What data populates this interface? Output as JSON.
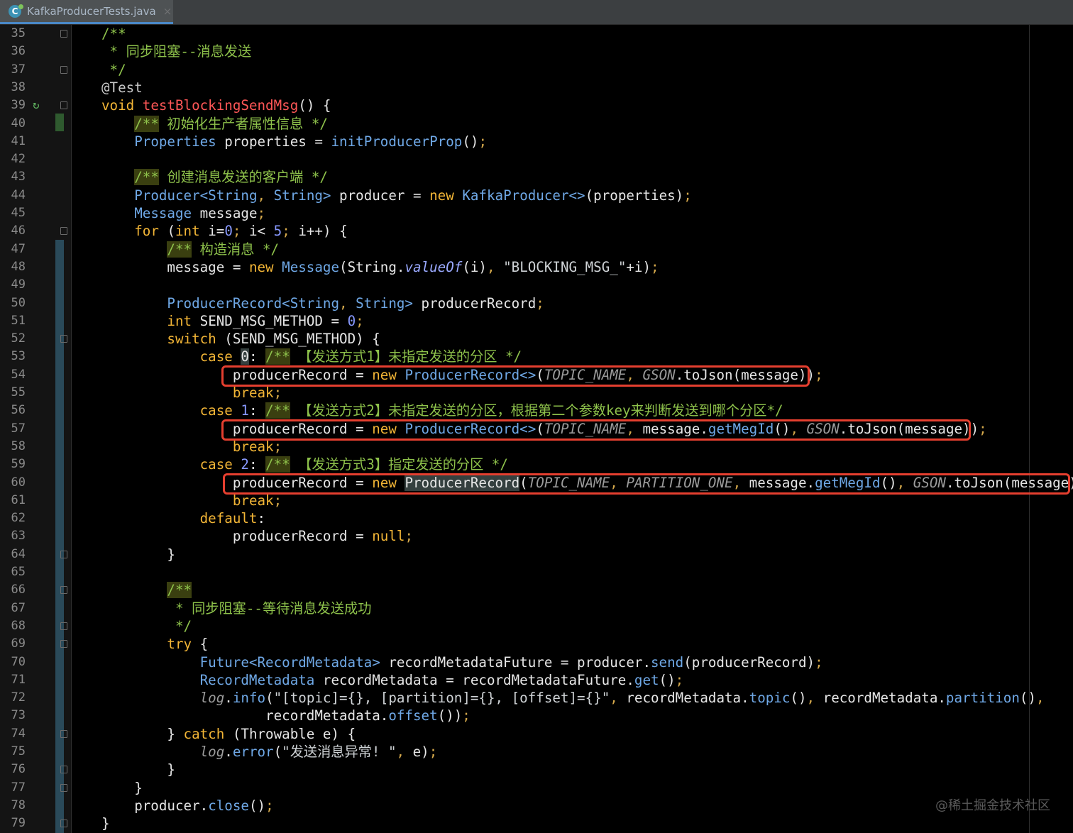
{
  "tab": {
    "title": "KafkaProducerTests.java",
    "close": "×",
    "icon": "c-class-icon"
  },
  "watermark": "@稀土掘金技术社区",
  "colors": {
    "keyword": "#f2b536",
    "comment": "#8ec24b",
    "type": "#6fa8e6",
    "method_decl": "#ff5757",
    "highlight_box": "#e53f2f"
  },
  "lines": [
    {
      "n": "35",
      "fold": true,
      "segs": [
        [
          "c",
          "/**"
        ]
      ]
    },
    {
      "n": "36",
      "segs": [
        [
          "c",
          " * 同步阻塞--消息发送"
        ]
      ]
    },
    {
      "n": "37",
      "fold": true,
      "segs": [
        [
          "c",
          " */"
        ]
      ]
    },
    {
      "n": "38",
      "segs": [
        [
          "a",
          "@Test"
        ]
      ]
    },
    {
      "n": "39",
      "fold": true,
      "run": true,
      "segs": [
        [
          "k",
          "void "
        ],
        [
          "f",
          "testBlockingSendMsg"
        ],
        [
          "",
          "() {"
        ]
      ]
    },
    {
      "n": "40",
      "segs": [
        [
          "",
          "    "
        ],
        [
          "cb",
          "/**"
        ],
        [
          "c",
          " 初始化生产者属性信息 */"
        ]
      ]
    },
    {
      "n": "41",
      "segs": [
        [
          "",
          "    "
        ],
        [
          "t",
          "Properties"
        ],
        [
          "",
          " properties = "
        ],
        [
          "m",
          "initProducerProp"
        ],
        [
          "",
          "()"
        ],
        [
          "p",
          ";"
        ]
      ]
    },
    {
      "n": "42",
      "segs": []
    },
    {
      "n": "43",
      "segs": [
        [
          "",
          "    "
        ],
        [
          "cb",
          "/**"
        ],
        [
          "c",
          " 创建消息发送的客户端 */"
        ]
      ]
    },
    {
      "n": "44",
      "segs": [
        [
          "",
          "    "
        ],
        [
          "t",
          "Producer<String"
        ],
        [
          "p",
          ", "
        ],
        [
          "t",
          "String>"
        ],
        [
          "",
          " producer = "
        ],
        [
          "k",
          "new "
        ],
        [
          "t",
          "KafkaProducer<>"
        ],
        [
          "",
          "(properties)"
        ],
        [
          "p",
          ";"
        ]
      ]
    },
    {
      "n": "45",
      "segs": [
        [
          "",
          "    "
        ],
        [
          "t",
          "Message"
        ],
        [
          "",
          " message"
        ],
        [
          "p",
          ";"
        ]
      ]
    },
    {
      "n": "46",
      "fold": true,
      "segs": [
        [
          "",
          "    "
        ],
        [
          "k",
          "for "
        ],
        [
          "",
          "("
        ],
        [
          "k",
          "int "
        ],
        [
          "",
          "i="
        ],
        [
          "n",
          "0"
        ],
        [
          "p",
          "; "
        ],
        [
          "",
          "i< "
        ],
        [
          "n",
          "5"
        ],
        [
          "p",
          "; "
        ],
        [
          "",
          "i++) {"
        ]
      ]
    },
    {
      "n": "47",
      "segs": [
        [
          "",
          "        "
        ],
        [
          "cb",
          "/**"
        ],
        [
          "c",
          " 构造消息 */"
        ]
      ]
    },
    {
      "n": "48",
      "segs": [
        [
          "",
          "        message = "
        ],
        [
          "k",
          "new "
        ],
        [
          "t",
          "Message"
        ],
        [
          "",
          "(String."
        ],
        [
          "ni",
          "valueOf"
        ],
        [
          "",
          "(i)"
        ],
        [
          "p",
          ", "
        ],
        [
          "s",
          "\"BLOCKING_MSG_\""
        ],
        [
          "",
          "+i)"
        ],
        [
          "p",
          ";"
        ]
      ]
    },
    {
      "n": "49",
      "segs": []
    },
    {
      "n": "50",
      "segs": [
        [
          "",
          "        "
        ],
        [
          "t",
          "ProducerRecord<String"
        ],
        [
          "p",
          ", "
        ],
        [
          "t",
          "String>"
        ],
        [
          "",
          " producerRecord"
        ],
        [
          "p",
          ";"
        ]
      ]
    },
    {
      "n": "51",
      "segs": [
        [
          "",
          "        "
        ],
        [
          "k",
          "int "
        ],
        [
          "",
          "SEND_MSG_METHOD = "
        ],
        [
          "n",
          "0"
        ],
        [
          "p",
          ";"
        ]
      ]
    },
    {
      "n": "52",
      "fold": true,
      "segs": [
        [
          "",
          "        "
        ],
        [
          "k",
          "switch "
        ],
        [
          "",
          "(SEND_MSG_METHOD) {"
        ]
      ]
    },
    {
      "n": "53",
      "segs": [
        [
          "",
          "            "
        ],
        [
          "k",
          "case "
        ],
        [
          "hl",
          "0"
        ],
        [
          "",
          ": "
        ],
        [
          "cb",
          "/**"
        ],
        [
          "c",
          " 【发送方式1】未指定发送的分区 */"
        ]
      ]
    },
    {
      "n": "54",
      "segs": [
        [
          "",
          "                producerRecord = "
        ],
        [
          "k",
          "new "
        ],
        [
          "t",
          "ProducerRecord<>"
        ],
        [
          "",
          "("
        ],
        [
          "ci",
          "TOPIC_NAME"
        ],
        [
          "p",
          ", "
        ],
        [
          "ci",
          "GSON"
        ],
        [
          "",
          ".toJson(message))"
        ],
        [
          "p",
          ";"
        ]
      ]
    },
    {
      "n": "55",
      "segs": [
        [
          "",
          "                "
        ],
        [
          "k",
          "break"
        ],
        [
          "p",
          ";"
        ]
      ]
    },
    {
      "n": "56",
      "segs": [
        [
          "",
          "            "
        ],
        [
          "k",
          "case "
        ],
        [
          "n",
          "1"
        ],
        [
          "",
          ": "
        ],
        [
          "cb",
          "/**"
        ],
        [
          "c",
          " 【发送方式2】未指定发送的分区，根据第二个参数key来判断发送到哪个分区*/"
        ]
      ]
    },
    {
      "n": "57",
      "segs": [
        [
          "",
          "                producerRecord = "
        ],
        [
          "k",
          "new "
        ],
        [
          "t",
          "ProducerRecord<>"
        ],
        [
          "",
          "("
        ],
        [
          "ci",
          "TOPIC_NAME"
        ],
        [
          "p",
          ", "
        ],
        [
          "",
          "message."
        ],
        [
          "m",
          "getMegId"
        ],
        [
          "",
          "()"
        ],
        [
          "p",
          ", "
        ],
        [
          "ci",
          "GSON"
        ],
        [
          "",
          ".toJson(message))"
        ],
        [
          "p",
          ";"
        ]
      ]
    },
    {
      "n": "58",
      "segs": [
        [
          "",
          "                "
        ],
        [
          "k",
          "break"
        ],
        [
          "p",
          ";"
        ]
      ]
    },
    {
      "n": "59",
      "segs": [
        [
          "",
          "            "
        ],
        [
          "k",
          "case "
        ],
        [
          "n",
          "2"
        ],
        [
          "",
          ": "
        ],
        [
          "cb",
          "/**"
        ],
        [
          "c",
          " 【发送方式3】指定发送的分区 */"
        ]
      ]
    },
    {
      "n": "60",
      "segs": [
        [
          "",
          "                producerRecord = "
        ],
        [
          "k",
          "new "
        ],
        [
          "hl",
          "ProducerRecord"
        ],
        [
          "",
          "("
        ],
        [
          "ci",
          "TOPIC_NAME"
        ],
        [
          "p",
          ", "
        ],
        [
          "ci",
          "PARTITION_ONE"
        ],
        [
          "p",
          ", "
        ],
        [
          "",
          "message."
        ],
        [
          "m",
          "getMegId"
        ],
        [
          "",
          "()"
        ],
        [
          "p",
          ", "
        ],
        [
          "ci",
          "GSON"
        ],
        [
          "",
          ".toJson(message))"
        ],
        [
          "p",
          ";"
        ]
      ]
    },
    {
      "n": "61",
      "segs": [
        [
          "",
          "                "
        ],
        [
          "k",
          "break"
        ],
        [
          "p",
          ";"
        ]
      ]
    },
    {
      "n": "62",
      "segs": [
        [
          "",
          "            "
        ],
        [
          "k",
          "default"
        ],
        [
          "",
          ":"
        ]
      ]
    },
    {
      "n": "63",
      "segs": [
        [
          "",
          "                producerRecord = "
        ],
        [
          "k",
          "null"
        ],
        [
          "p",
          ";"
        ]
      ]
    },
    {
      "n": "64",
      "fold": true,
      "segs": [
        [
          "",
          "        }"
        ]
      ]
    },
    {
      "n": "65",
      "segs": []
    },
    {
      "n": "66",
      "fold": true,
      "segs": [
        [
          "",
          "        "
        ],
        [
          "cb",
          "/**"
        ]
      ]
    },
    {
      "n": "67",
      "segs": [
        [
          "c",
          "         * 同步阻塞--等待消息发送成功"
        ]
      ]
    },
    {
      "n": "68",
      "fold": true,
      "segs": [
        [
          "c",
          "         */"
        ]
      ]
    },
    {
      "n": "69",
      "fold": true,
      "segs": [
        [
          "",
          "        "
        ],
        [
          "k",
          "try "
        ],
        [
          "",
          "{"
        ]
      ]
    },
    {
      "n": "70",
      "segs": [
        [
          "",
          "            "
        ],
        [
          "t",
          "Future<RecordMetadata>"
        ],
        [
          "",
          " recordMetadataFuture = producer."
        ],
        [
          "m",
          "send"
        ],
        [
          "",
          "(producerRecord)"
        ],
        [
          "p",
          ";"
        ]
      ]
    },
    {
      "n": "71",
      "segs": [
        [
          "",
          "            "
        ],
        [
          "t",
          "RecordMetadata"
        ],
        [
          "",
          " recordMetadata = recordMetadataFuture."
        ],
        [
          "m",
          "get"
        ],
        [
          "",
          "()"
        ],
        [
          "p",
          ";"
        ]
      ]
    },
    {
      "n": "72",
      "segs": [
        [
          "",
          "            "
        ],
        [
          "ci",
          "log"
        ],
        [
          "",
          "."
        ],
        [
          "m",
          "info"
        ],
        [
          "",
          "("
        ],
        [
          "s",
          "\"[topic]={}, [partition]={}, [offset]={}\""
        ],
        [
          "p",
          ", "
        ],
        [
          "",
          "recordMetadata."
        ],
        [
          "m",
          "topic"
        ],
        [
          "",
          "()"
        ],
        [
          "p",
          ", "
        ],
        [
          "",
          "recordMetadata."
        ],
        [
          "m",
          "partition"
        ],
        [
          "",
          "()"
        ],
        [
          "p",
          ","
        ]
      ]
    },
    {
      "n": "73",
      "segs": [
        [
          "",
          "                    recordMetadata."
        ],
        [
          "m",
          "offset"
        ],
        [
          "",
          "())"
        ],
        [
          "p",
          ";"
        ]
      ]
    },
    {
      "n": "74",
      "fold": true,
      "segs": [
        [
          "",
          "        } "
        ],
        [
          "k",
          "catch "
        ],
        [
          "",
          "(Throwable e) {"
        ]
      ]
    },
    {
      "n": "75",
      "segs": [
        [
          "",
          "            "
        ],
        [
          "ci",
          "log"
        ],
        [
          "",
          "."
        ],
        [
          "m",
          "error"
        ],
        [
          "",
          "("
        ],
        [
          "s",
          "\"发送消息异常! \""
        ],
        [
          "p",
          ", "
        ],
        [
          "",
          "e)"
        ],
        [
          "p",
          ";"
        ]
      ]
    },
    {
      "n": "76",
      "fold": true,
      "segs": [
        [
          "",
          "        }"
        ]
      ]
    },
    {
      "n": "77",
      "fold": true,
      "segs": [
        [
          "",
          "    }"
        ]
      ]
    },
    {
      "n": "78",
      "segs": [
        [
          "",
          "    producer."
        ],
        [
          "m",
          "close"
        ],
        [
          "",
          "()"
        ],
        [
          "p",
          ";"
        ]
      ]
    },
    {
      "n": "79",
      "fold": true,
      "segs": [
        [
          "",
          "}"
        ]
      ]
    }
  ]
}
